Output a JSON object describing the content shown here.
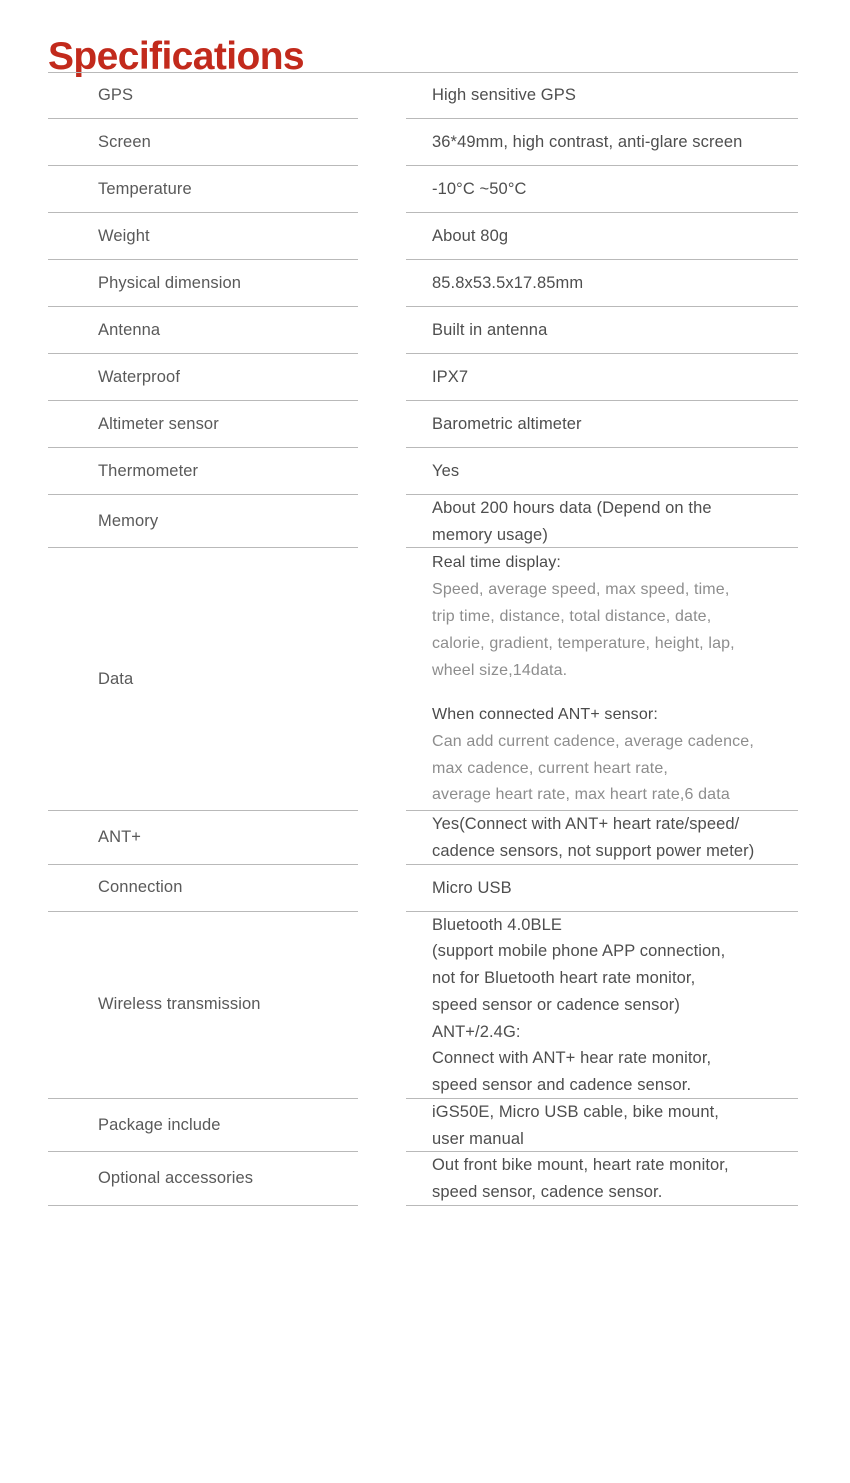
{
  "page": {
    "title": "Specifications",
    "title_color": "#c22a1c",
    "rule_color": "#b9b9b9",
    "label_color": "#595959",
    "value_color": "#4e4e4e",
    "data_head_color": "#4a4a4a",
    "data_body_color": "#8d8d8d"
  },
  "rows": [
    {
      "label": "GPS",
      "value_lines": [
        "High sensitive GPS"
      ]
    },
    {
      "label": "Screen",
      "value_lines": [
        "36*49mm, high contrast, anti-glare screen"
      ]
    },
    {
      "label": "Temperature",
      "value_lines": [
        "-10°C ~50°C"
      ]
    },
    {
      "label": "Weight",
      "value_lines": [
        "About 80g"
      ]
    },
    {
      "label": "Physical dimension",
      "value_lines": [
        "85.8x53.5x17.85mm"
      ]
    },
    {
      "label": "Antenna",
      "value_lines": [
        "Built in antenna"
      ]
    },
    {
      "label": "Waterproof",
      "value_lines": [
        "IPX7"
      ]
    },
    {
      "label": "Altimeter sensor",
      "value_lines": [
        "Barometric altimeter"
      ]
    },
    {
      "label": "Thermometer",
      "value_lines": [
        "Yes"
      ]
    },
    {
      "label": "Memory",
      "value_lines": [
        "About 200 hours data (Depend on the",
        "memory usage)"
      ]
    },
    {
      "label": "Data",
      "groups": [
        {
          "head": "Real time display:",
          "body_lines": [
            "Speed, average speed, max speed, time,",
            "trip time, distance, total distance, date,",
            "calorie, gradient, temperature, height, lap,",
            "wheel size,14data."
          ]
        },
        {
          "head": "When connected ANT+ sensor:",
          "body_lines": [
            "Can add current cadence, average cadence,",
            "max cadence, current heart rate,",
            "average heart rate, max heart rate,6 data"
          ]
        }
      ]
    },
    {
      "label": "ANT+",
      "value_lines": [
        "Yes(Connect with ANT+ heart rate/speed/",
        "cadence sensors, not support power meter)"
      ]
    },
    {
      "label": "Connection",
      "value_lines": [
        "Micro USB"
      ]
    },
    {
      "label": "Wireless transmission",
      "value_lines": [
        "Bluetooth 4.0BLE",
        "(support mobile phone APP connection,",
        "not for Bluetooth heart rate monitor,",
        "speed sensor or cadence sensor)",
        "ANT+/2.4G:",
        "Connect with ANT+ hear rate monitor,",
        "speed sensor and cadence sensor."
      ]
    },
    {
      "label": "Package include",
      "value_lines": [
        "iGS50E, Micro USB cable, bike mount,",
        "user manual"
      ]
    },
    {
      "label": "Optional accessories",
      "value_lines": [
        "Out front bike mount, heart rate monitor,",
        "speed sensor, cadence sensor."
      ]
    }
  ]
}
